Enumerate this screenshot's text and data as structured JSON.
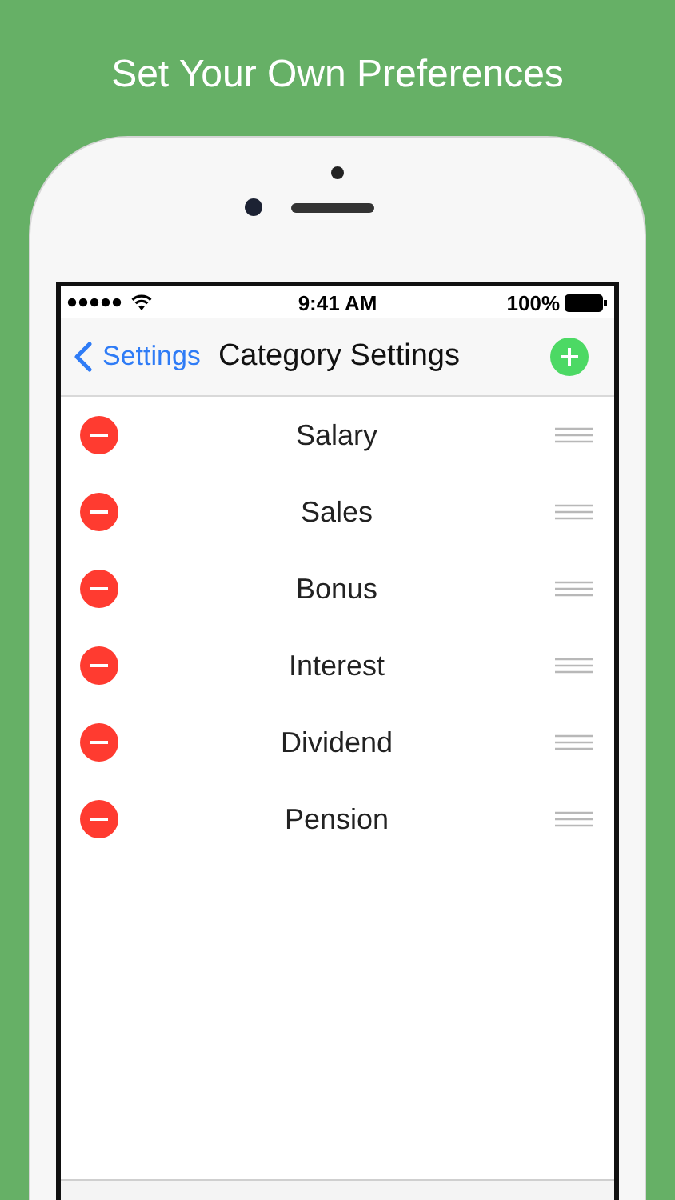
{
  "headline": "Set Your Own Preferences",
  "status_bar": {
    "time": "9:41 AM",
    "battery": "100%"
  },
  "nav": {
    "back_label": "Settings",
    "title": "Category Settings"
  },
  "categories": [
    {
      "name": "Salary"
    },
    {
      "name": "Sales"
    },
    {
      "name": "Bonus"
    },
    {
      "name": "Interest"
    },
    {
      "name": "Dividend"
    },
    {
      "name": "Pension"
    }
  ]
}
